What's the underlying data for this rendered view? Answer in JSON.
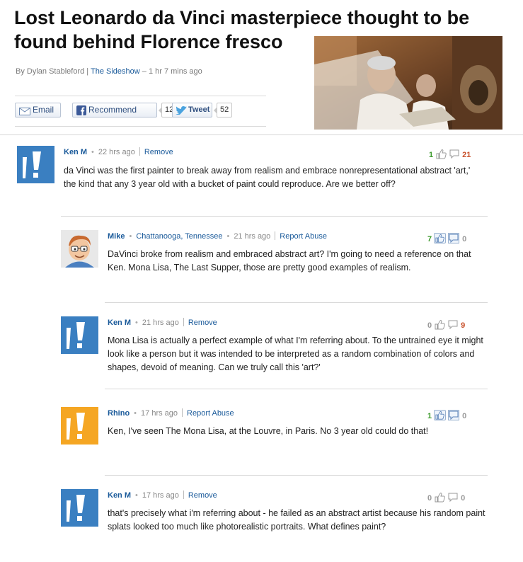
{
  "article": {
    "headline_line1": "Lost Leonardo da Vinci masterpiece thought to be",
    "headline_line2": "found behind Florence fresco",
    "byline_prefix": "By Dylan Stableford |",
    "byline_source": "The Sideshow",
    "byline_time": "– 1 hr 7 mins ago"
  },
  "share": {
    "email_label": "Email",
    "recommend_label": "Recommend",
    "recommend_count": "12",
    "tweet_label": "Tweet",
    "tweet_count": "52"
  },
  "comments": [
    {
      "author": "Ken M",
      "time": "22 hrs ago",
      "action": "Remove",
      "up": "1",
      "down": "21",
      "avatar_color": "#3a7fc1",
      "text": "da Vinci was the first painter to break away from realism and embrace nonrepresentational abstract 'art,' the kind that any 3 year old with a bucket of paint could reproduce. Are we better off?"
    },
    {
      "author": "Mike",
      "location": "Chattanooga, Tennessee",
      "time": "21 hrs ago",
      "action": "Report Abuse",
      "up": "7",
      "down": "0",
      "text": "DaVinci broke from realism and embraced abstract art? I'm going to need a reference on that Ken. Mona Lisa, The Last Supper, those are pretty good examples of realism."
    },
    {
      "author": "Ken M",
      "time": "21 hrs ago",
      "action": "Remove",
      "up": "0",
      "down": "9",
      "avatar_color": "#3a7fc1",
      "text": "Mona Lisa is actually a perfect example of what I'm referring about. To the untrained eye it might look like a person but it was intended to be interpreted as a random combination of colors and shapes, devoid of meaning. Can we truly call this 'art?'"
    },
    {
      "author": "Rhino",
      "time": "17 hrs ago",
      "action": "Report Abuse",
      "up": "1",
      "down": "0",
      "avatar_color": "#f5a623",
      "text": "Ken, I've seen The Mona Lisa, at the Louvre, in Paris. No 3 year old could do that!"
    },
    {
      "author": "Ken M",
      "time": "17 hrs ago",
      "action": "Remove",
      "up": "0",
      "down": "0",
      "avatar_color": "#3a7fc1",
      "text": "that's precisely what i'm referring about - he failed as an abstract artist because his random paint splats looked too much like photorealistic portraits. What defines paint?"
    }
  ]
}
